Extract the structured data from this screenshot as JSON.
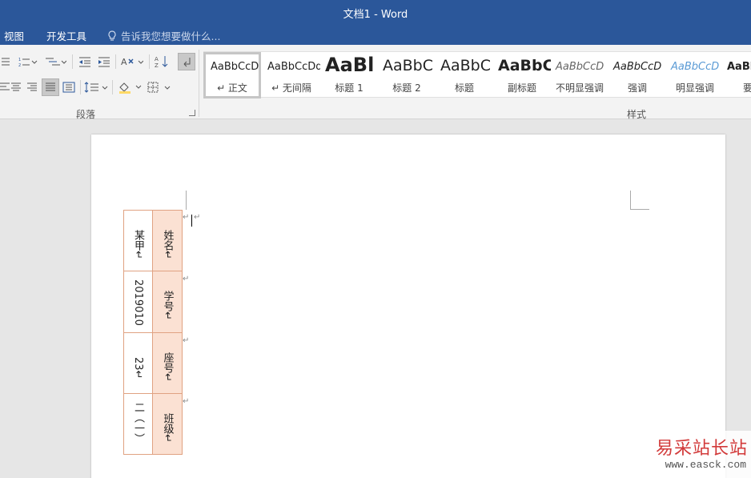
{
  "window": {
    "title": "文档1 - Word"
  },
  "menu": {
    "items": [
      "视图",
      "开发工具"
    ],
    "tell_me": "告诉我您想要做什么..."
  },
  "ribbon": {
    "paragraph_group_label": "段落",
    "styles_group_label": "样式",
    "styles": [
      {
        "sample": "AaBbCcDd",
        "name": "↵ 正文"
      },
      {
        "sample": "AaBbCcDd",
        "name": "↵ 无间隔"
      },
      {
        "sample": "AaBl",
        "name": "标题 1"
      },
      {
        "sample": "AaBbC",
        "name": "标题 2"
      },
      {
        "sample": "AaBbC",
        "name": "标题"
      },
      {
        "sample": "AaBbC",
        "name": "副标题"
      },
      {
        "sample": "AaBbCcD",
        "name": "不明显强调"
      },
      {
        "sample": "AaBbCcD",
        "name": "强调"
      },
      {
        "sample": "AaBbCcD",
        "name": "明显强调"
      },
      {
        "sample": "AaBb",
        "name": "要"
      }
    ]
  },
  "document": {
    "paragraph_mark": "↵",
    "table": {
      "rows": [
        {
          "header": "姓名↵",
          "value": "某甲↵"
        },
        {
          "header": "学号↵",
          "value": "2019010"
        },
        {
          "header": "座号↵",
          "value": "23↵"
        },
        {
          "header": "班级↵",
          "value": "二（一）"
        }
      ]
    }
  },
  "watermark": {
    "text": "易采站长站",
    "url": "www.easck.com"
  },
  "colors": {
    "title_bar": "#2b579a",
    "table_header_fill": "#fbe1d3",
    "table_border": "#e0a282",
    "watermark_red": "#d23a3a"
  }
}
